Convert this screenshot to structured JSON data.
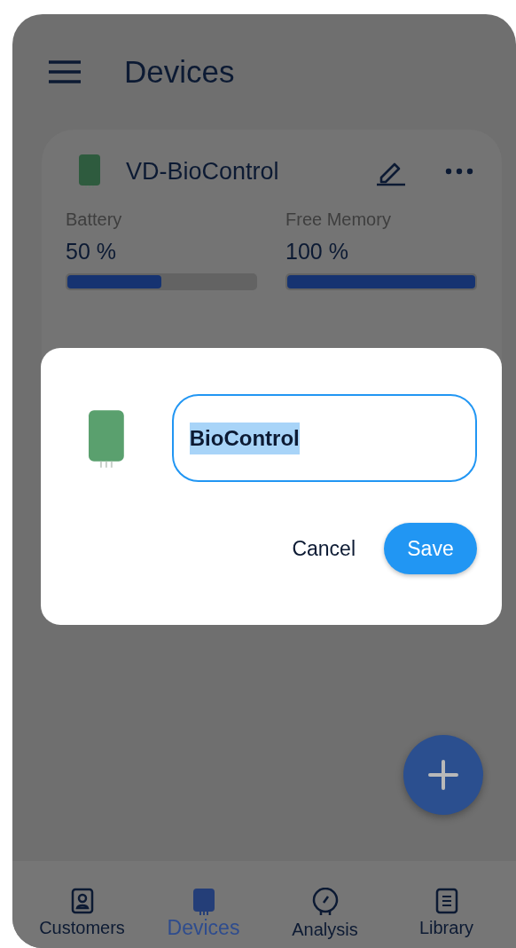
{
  "header": {
    "title": "Devices"
  },
  "device_card": {
    "name": "VD-BioControl",
    "metrics": [
      {
        "label": "Battery",
        "value": "50 %",
        "level": 0.5
      },
      {
        "label": "Free Memory",
        "value": "100 %",
        "level": 1
      }
    ]
  },
  "rename_dialog": {
    "value": "BioControl",
    "text_selected": true,
    "buttons": [
      {
        "label": "Cancel",
        "kind": "text"
      },
      {
        "label": "Save",
        "kind": "filled"
      }
    ]
  },
  "bottom_nav": [
    {
      "label": "Customers",
      "selected": false
    },
    {
      "label": "Devices",
      "selected": true
    },
    {
      "label": "Analysis",
      "selected": false
    },
    {
      "label": "Library",
      "selected": false
    }
  ]
}
